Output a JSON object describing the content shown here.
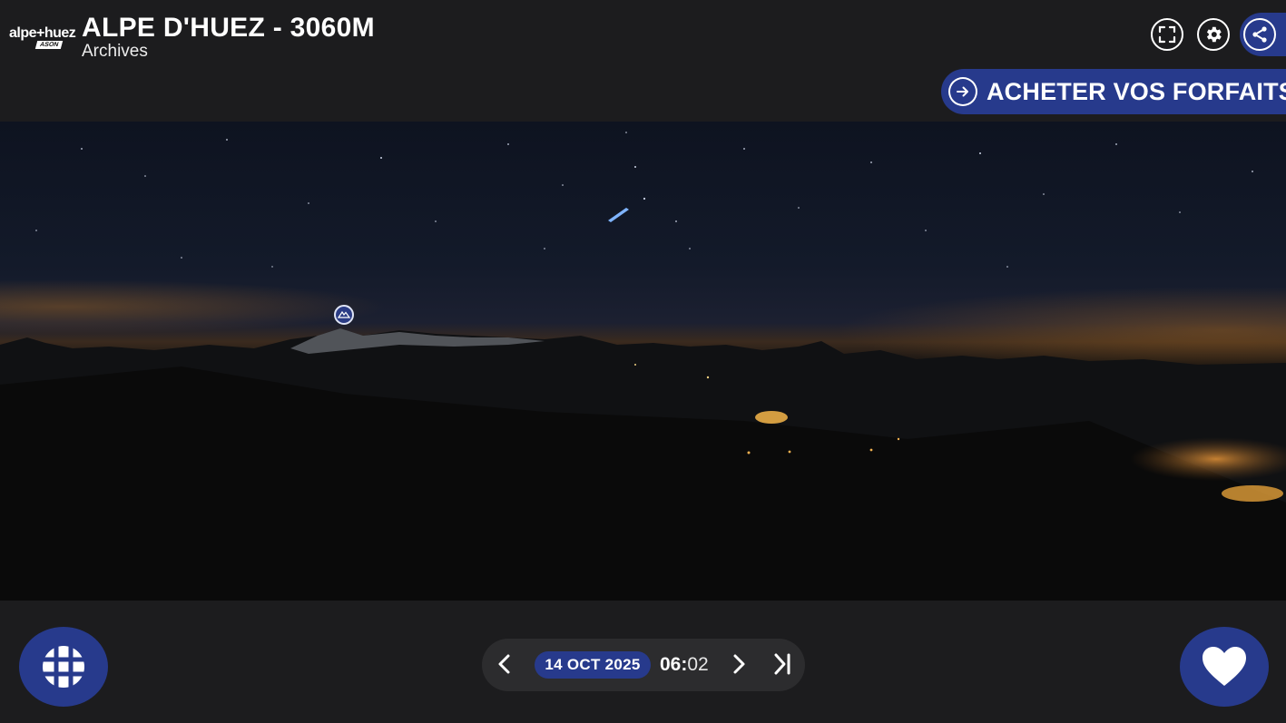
{
  "header": {
    "logo_text": "alpe+huez",
    "logo_sub": "ASON",
    "title": "ALPE D'HUEZ - 3060M",
    "subtitle": "Archives",
    "icons": [
      "fullscreen-icon",
      "gear-icon",
      "share-icon"
    ]
  },
  "cta": {
    "label": "ACHETER VOS FORFAITS",
    "icon": "arrow-right-circle-icon"
  },
  "panorama": {
    "poi_icon": "mountain-marker-icon"
  },
  "timeline": {
    "date": "14 OCT 2025",
    "hour": "06",
    "separator": ":",
    "minute": "02",
    "prev_icon": "chevron-left-icon",
    "next_icon": "chevron-right-icon",
    "latest_icon": "skip-to-end-icon"
  },
  "footer": {
    "grid_icon": "grid-globe-icon",
    "favorite_icon": "heart-icon"
  },
  "colors": {
    "brand_blue": "#273a8c",
    "background": "#1c1c1e",
    "pill": "#2c2c2e"
  }
}
